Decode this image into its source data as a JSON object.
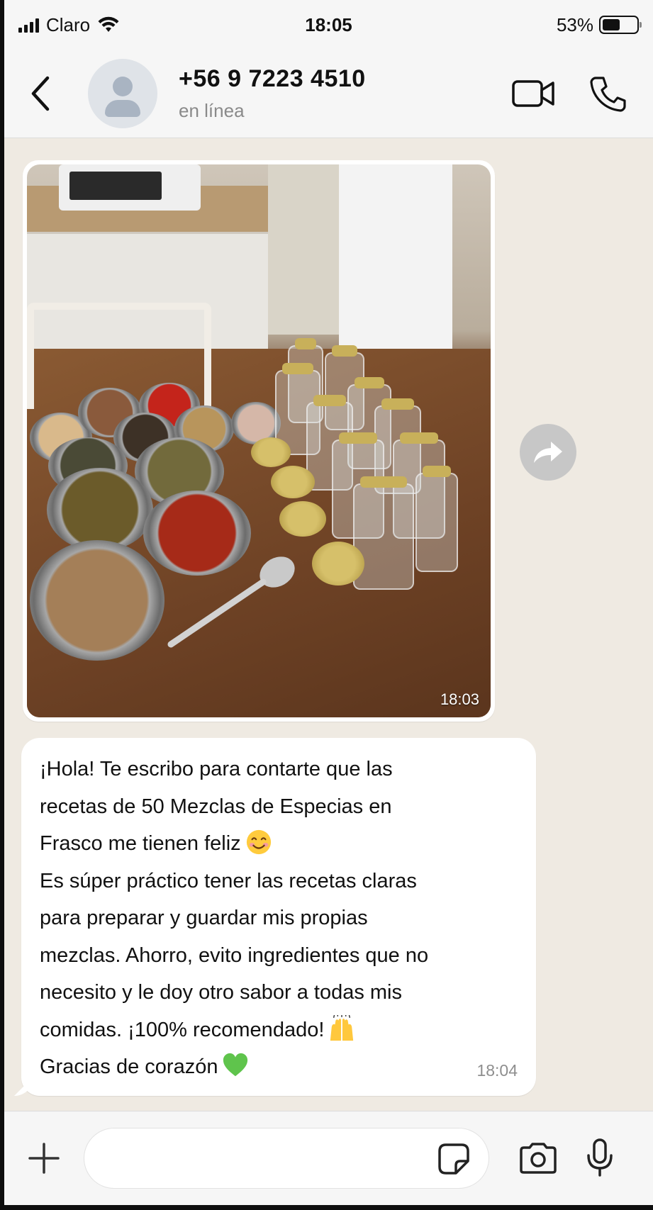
{
  "status_bar": {
    "carrier": "Claro",
    "time": "18:05",
    "battery": "53%",
    "battery_level": 0.53
  },
  "header": {
    "contact_name": "+56 9 7223 4510",
    "contact_status": "en línea"
  },
  "messages": [
    {
      "type": "image",
      "time": "18:03",
      "icon": "kitchen-spices-photo"
    },
    {
      "type": "text",
      "time": "18:04",
      "lines": [
        "¡Hola! Te escribo para contarte que las",
        "recetas de 50 Mezclas de Especias en",
        "Frasco me tienen feliz",
        "Es súper práctico tener las recetas claras",
        "para preparar y guardar mis propias",
        "mezclas. Ahorro, evito ingredientes que no",
        "necesito y le doy otro sabor  a todas mis",
        "comidas. ¡100% recomendado!",
        "Gracias de corazón"
      ]
    }
  ],
  "input": {
    "placeholder": ""
  },
  "icons": {
    "back": "chevron-left-icon",
    "video": "video-camera-icon",
    "phone": "phone-icon",
    "forward": "forward-arrow-icon",
    "plus": "plus-icon",
    "sticker": "sticker-icon",
    "camera": "camera-icon",
    "mic": "microphone-icon"
  },
  "colors": {
    "chat_background": "#efeae2",
    "bubble": "#ffffff",
    "header": "#f6f6f6"
  }
}
